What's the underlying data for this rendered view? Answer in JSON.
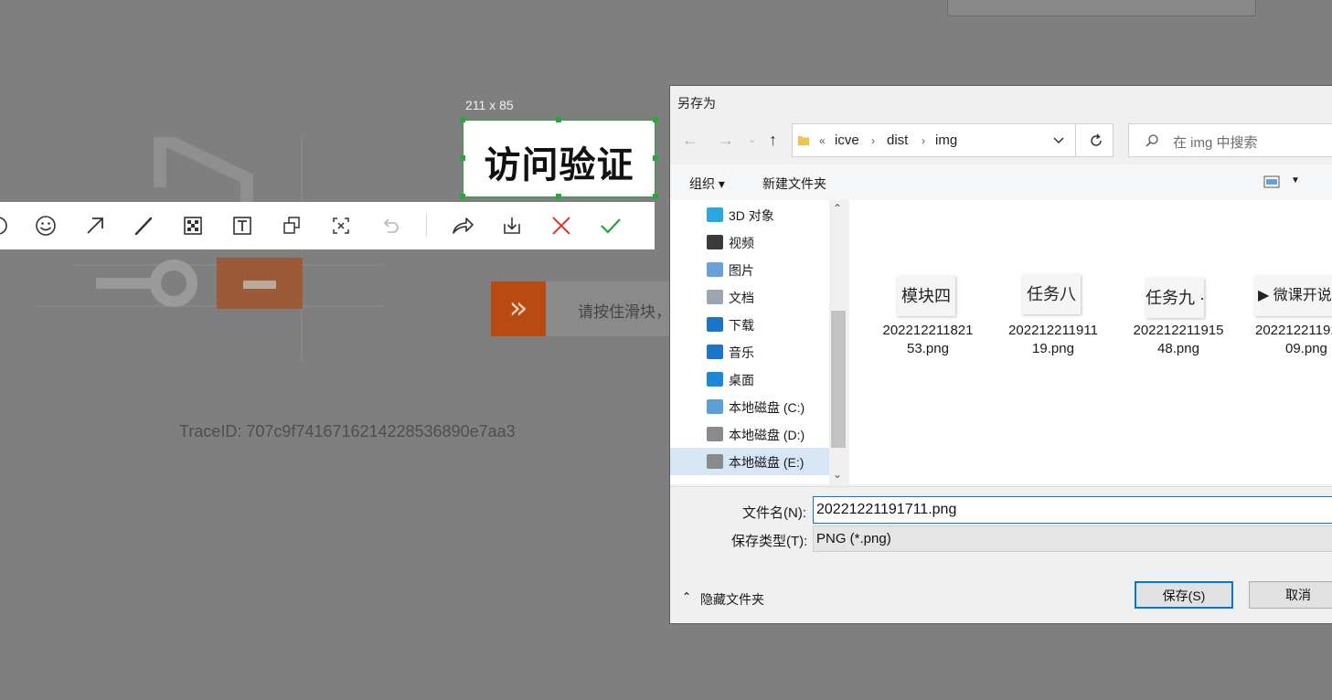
{
  "background": {
    "slider_hint": "请按住滑块，",
    "trace_id": "TraceID: 707c9f7416716214228536890e7aa3",
    "partial_char": "问"
  },
  "capture": {
    "size_label": "211 x 85",
    "selected_text": "访问验证"
  },
  "toolbar": {
    "tools": [
      "circle-tool-icon",
      "emoji-icon",
      "arrow-icon",
      "pen-icon",
      "mosaic-icon",
      "text-icon",
      "pin-icon",
      "ocr-icon",
      "undo-icon",
      "share-icon",
      "download-icon",
      "cancel-icon",
      "confirm-icon"
    ]
  },
  "dialog": {
    "title": "另存为",
    "breadcrumb": [
      "«",
      "icve",
      "dist",
      "img"
    ],
    "search_placeholder": "在 img 中搜索",
    "commands": {
      "organize": "组织 ▾",
      "new_folder": "新建文件夹"
    },
    "nav_items": [
      {
        "label": "3D 对象",
        "icon": "3d-objects-icon",
        "color": "#29a8e0"
      },
      {
        "label": "视频",
        "icon": "video-icon",
        "color": "#3a3a3a"
      },
      {
        "label": "图片",
        "icon": "pictures-icon",
        "color": "#6aa0d8"
      },
      {
        "label": "文档",
        "icon": "documents-icon",
        "color": "#9aa7b3"
      },
      {
        "label": "下载",
        "icon": "downloads-icon",
        "color": "#1e74c9"
      },
      {
        "label": "音乐",
        "icon": "music-icon",
        "color": "#1e74c9"
      },
      {
        "label": "桌面",
        "icon": "desktop-icon",
        "color": "#1a8ad8"
      },
      {
        "label": "本地磁盘 (C:)",
        "icon": "drive-c-icon",
        "color": "#5aa0d6"
      },
      {
        "label": "本地磁盘 (D:)",
        "icon": "drive-d-icon",
        "color": "#8a8a8a"
      },
      {
        "label": "本地磁盘 (E:)",
        "icon": "drive-e-icon",
        "color": "#8a8a8a"
      }
    ],
    "files": [
      {
        "thumb": "模块四",
        "name_line1": "202212211821",
        "name_line2": "53.png"
      },
      {
        "thumb": "任务八",
        "name_line1": "202212211911",
        "name_line2": "19.png"
      },
      {
        "thumb": "任务九 ·",
        "name_line1": "202212211915",
        "name_line2": "48.png"
      },
      {
        "thumb": "▶ 微课开说",
        "name_line1": "20221221191",
        "name_line2": "09.png"
      }
    ],
    "filename_label": "文件名(N):",
    "filename_value": "20221221191711.png",
    "filetype_label": "保存类型(T):",
    "filetype_value": "PNG (*.png)",
    "hide_folders": "隐藏文件夹",
    "save_button": "保存(S)",
    "cancel_button": "取消"
  },
  "colors": {
    "accent": "#0078d7",
    "capture_border": "#2ea43c",
    "slider_orange": "#b94a11",
    "cancel_red": "#e0352e",
    "confirm_green": "#20a33a"
  }
}
